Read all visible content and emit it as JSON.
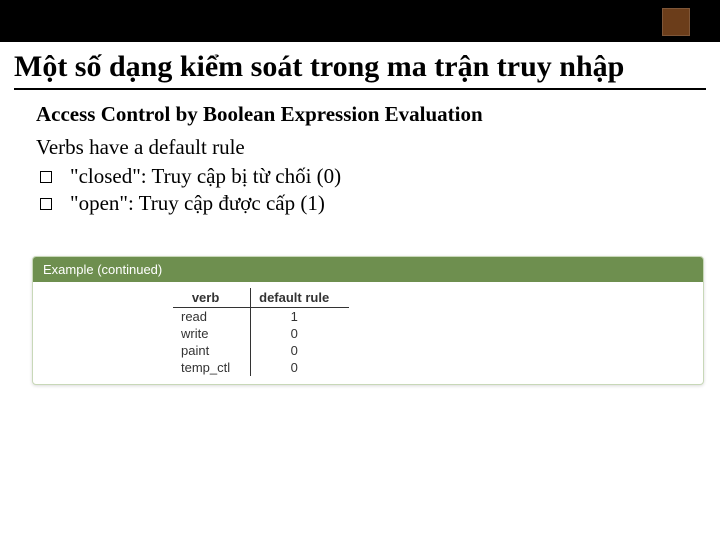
{
  "title": "Một số dạng kiểm soát trong ma trận truy nhập",
  "subtitle": "Access Control by Boolean Expression Evaluation",
  "line1": "Verbs have a default rule",
  "bullets": [
    "\"closed\": Truy cập bị từ chối (0)",
    "\"open\": Truy cập được cấp (1)"
  ],
  "example": {
    "header": "Example (continued)",
    "columns": [
      "verb",
      "default rule"
    ],
    "rows": [
      {
        "verb": "read",
        "rule": "1"
      },
      {
        "verb": "write",
        "rule": "0"
      },
      {
        "verb": "paint",
        "rule": "0"
      },
      {
        "verb": "temp_ctl",
        "rule": "0"
      }
    ]
  }
}
